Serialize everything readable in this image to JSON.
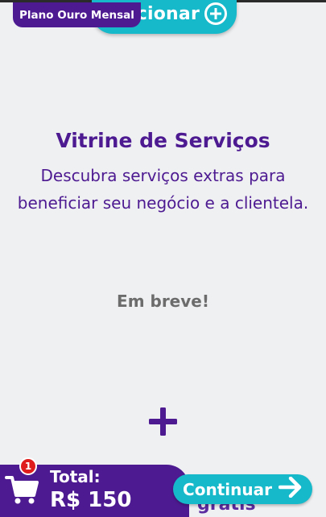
{
  "header": {
    "add_button_label": "icionar",
    "plan_badge": "Plano Ouro Mensal"
  },
  "hero": {
    "title": "Vitrine de Serviços",
    "subtitle": "Descubra serviços extras para beneficiar seu negócio e a clientela."
  },
  "main": {
    "soon_text": "Em breve!"
  },
  "footer": {
    "cart_count": "1",
    "total_label": "Total:",
    "total_value": "R$ 150",
    "continue_label": "Continuar",
    "hidden_text": "grátis"
  },
  "colors": {
    "primary": "#4e1a91",
    "accent": "#16b9c9",
    "badge": "#e01d1d",
    "background": "#eef0f2"
  },
  "icons": {
    "add": "plus-circle-icon",
    "add_service": "plus-icon",
    "cart": "cart-icon",
    "continue": "arrow-right-icon"
  }
}
